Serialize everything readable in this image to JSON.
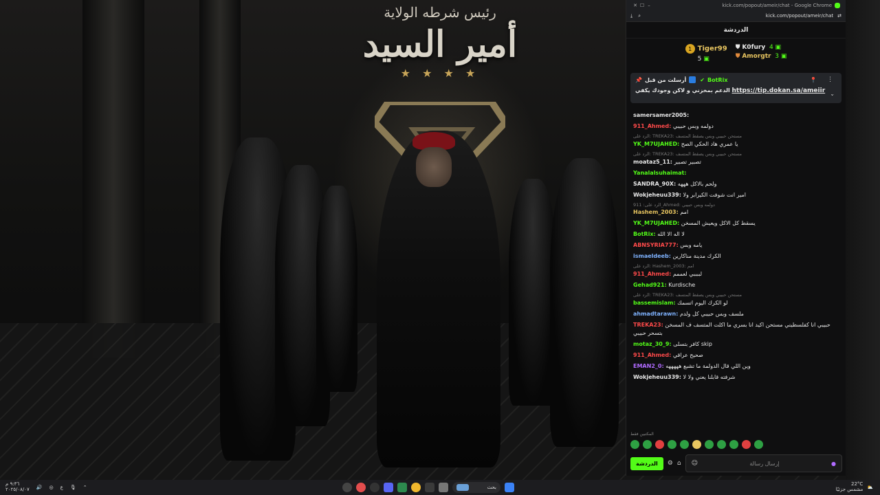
{
  "wallpaper": {
    "subtitle": "رئيس شرطه الولاية",
    "title": "أمير السيد",
    "stars": "★ ★ ★ ★"
  },
  "browser": {
    "window_title": "kick.com/popout/ameir/chat - Google Chrome",
    "url": "kick.com/popout/ameir/chat"
  },
  "chat": {
    "title": "الدردشة",
    "leaderboard": [
      {
        "rank": "1",
        "name": "Tiger99",
        "count": "5"
      },
      {
        "name": "K0fury",
        "count": "4"
      },
      {
        "name": "Amorgtr",
        "count": "3"
      }
    ],
    "pinned": {
      "sender": "BotRix",
      "sent_by": "أرسلت من قبل",
      "text": "الدعم بمخزني و لاكن وجودك يكفي",
      "link": "https://tip.dokan.sa/ameiir"
    },
    "messages": [
      {
        "user": "samersamer2005:",
        "text": "",
        "color": "#e8e8e8"
      },
      {
        "user": "911_Ahmed:",
        "text": "دولمه وبس حبيبي",
        "color": "#ff4a4a"
      },
      {
        "reply": "الرد على: TREKA23: مستحن حبيبي وبس يصقط المتسف",
        "user": "YK_M7UJAHED:",
        "text": "يا عمري هاد الحكي الصح",
        "color": "#53fc18"
      },
      {
        "reply": "الرد على: TREKA23: مستحن حبيبي وبس يصقط المتسف",
        "user": "moataz5_11:",
        "text": "تصبير تصبير",
        "color": "#e8e8e8"
      },
      {
        "user": "Yanalalsuhaimat:",
        "text": "",
        "color": "#53fc18"
      },
      {
        "user": "SANDRA_90X:",
        "text": "ولحم بالاكل هههه",
        "color": "#e8e8e8"
      },
      {
        "user": "Wokjeheuu339:",
        "text": "امير انت شوفت الكيرابر ولا",
        "color": "#e8e8e8"
      },
      {
        "reply": "الرد على: 911_Ahmed: دولمه وبس حبيبي",
        "user": "Hashem_2003:",
        "text": "امم",
        "color": "#e8c560"
      },
      {
        "user": "YK_M7UJAHED:",
        "text": "يسقط كل الاكل ويعيش المسخن",
        "color": "#53fc18"
      },
      {
        "user": "BotRix:",
        "text": "لا اله الا الله",
        "color": "#53fc18"
      },
      {
        "user": "ABNSYRIA777:",
        "text": "يامه وبس",
        "color": "#ff4a4a"
      },
      {
        "user": "ismaeldeeb:",
        "text": "الكرك مدينة مناكارين",
        "color": "#7fb3ff"
      },
      {
        "reply": "الرد على: Hashem_2003: امم",
        "user": "911_Ahmed:",
        "text": "لببببي لعممم",
        "color": "#ff4a4a"
      },
      {
        "user": "Gehad921:",
        "text": "Kurdische",
        "color": "#53fc18"
      },
      {
        "reply": "الرد على: TREKA23: مستحن حبيبي وبس يصقط المتسف",
        "user": "bassemislam:",
        "text": "لو الكرك اليوم اتسمك",
        "color": "#53fc18"
      },
      {
        "user": "ahmadtarawn:",
        "text": "ملسف وبس حبيبي كل ولدم",
        "color": "#7fb3ff"
      },
      {
        "user": "TREKA23:",
        "text": "حبيبي انا كفلسطيني مستحن اكيد انا بسري ما اكلت المتسف ف المسخن بتسحر حبيبي",
        "color": "#ff4a4a"
      },
      {
        "user": "motaz_30_9:",
        "text": "كافر بتسلى skip",
        "color": "#53fc18"
      },
      {
        "user": "911_Ahmed:",
        "text": "صحيح عراقي",
        "color": "#ff4a4a"
      },
      {
        "user": "EMAN2_0:",
        "text": "وين اللي قال الدولمة ما تشبع هههههه",
        "color": "#b06bff"
      },
      {
        "user": "Wokjeheuu339:",
        "text": "شرفته قابلنا يعني ولا لا",
        "color": "#e8e8e8"
      }
    ],
    "favorites_label": "المكتبين فقط",
    "input_placeholder": "إرسال رسالة",
    "send_button": "الدردشة"
  },
  "taskbar": {
    "search": "بحث",
    "weather": "22°C",
    "weather_sub": "مشمس جزئيًا",
    "lang": "ع",
    "time": "٩:٣٦ م",
    "date": "٢٠٢٥/٠٨/٠٧"
  }
}
